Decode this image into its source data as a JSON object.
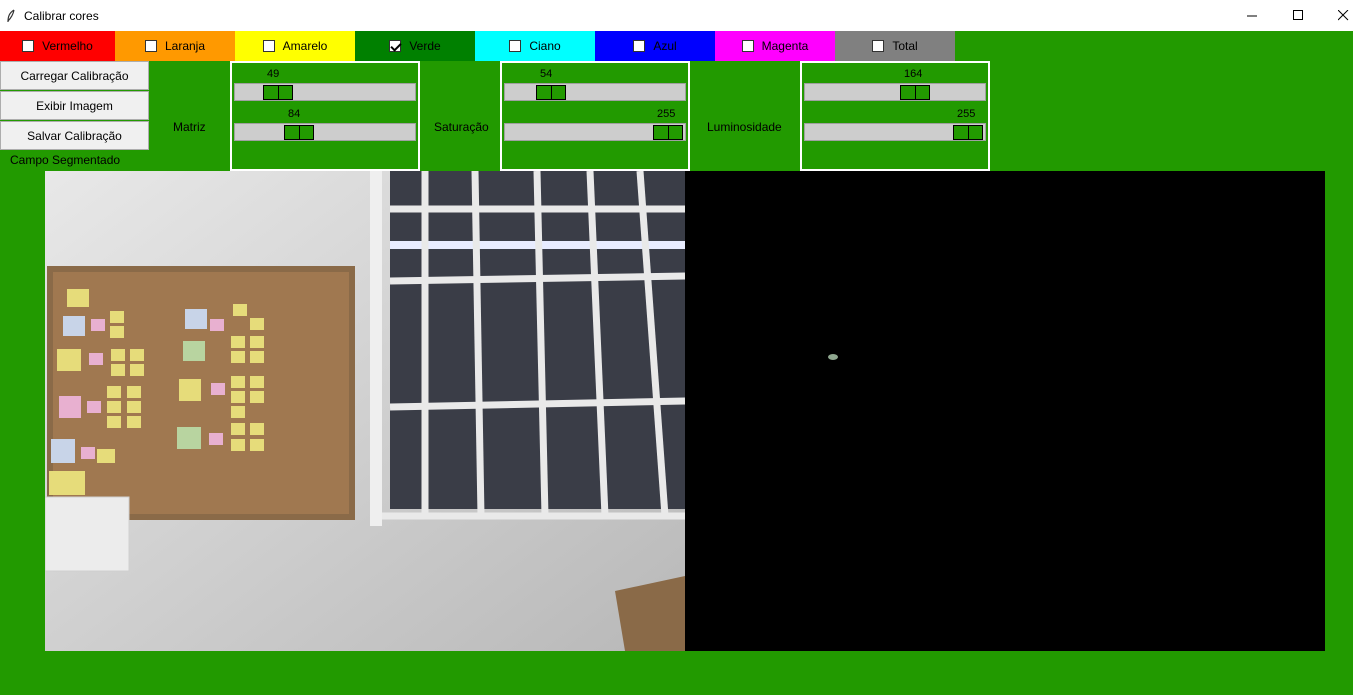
{
  "window": {
    "title": "Calibrar cores"
  },
  "tabs": [
    {
      "label": "Vermelho",
      "bg": "#ff0000",
      "checked": false
    },
    {
      "label": "Laranja",
      "bg": "#ff9900",
      "checked": false
    },
    {
      "label": "Amarelo",
      "bg": "#ffff00",
      "checked": false
    },
    {
      "label": "Verde",
      "bg": "#008000",
      "checked": true
    },
    {
      "label": "Ciano",
      "bg": "#00ffff",
      "checked": false
    },
    {
      "label": "Azul",
      "bg": "#0000ff",
      "checked": false
    },
    {
      "label": "Magenta",
      "bg": "#ff00ff",
      "checked": false
    },
    {
      "label": "Total",
      "bg": "#808080",
      "checked": false
    }
  ],
  "buttons": {
    "load": "Carregar Calibração",
    "show": "Exibir Imagem",
    "save": "Salvar Calibração"
  },
  "campo_label": "Campo Segmentado",
  "labels": {
    "matriz": "Matriz",
    "saturacao": "Saturação",
    "luminosidade": "Luminosidade"
  },
  "sliders": {
    "max": 255,
    "matriz_min": 49,
    "matriz_max": 84,
    "sat_min": 54,
    "sat_max": 255,
    "lum_min": 164,
    "lum_max": 255
  },
  "colors": {
    "background": "#229a00",
    "accent": "#229a00"
  }
}
